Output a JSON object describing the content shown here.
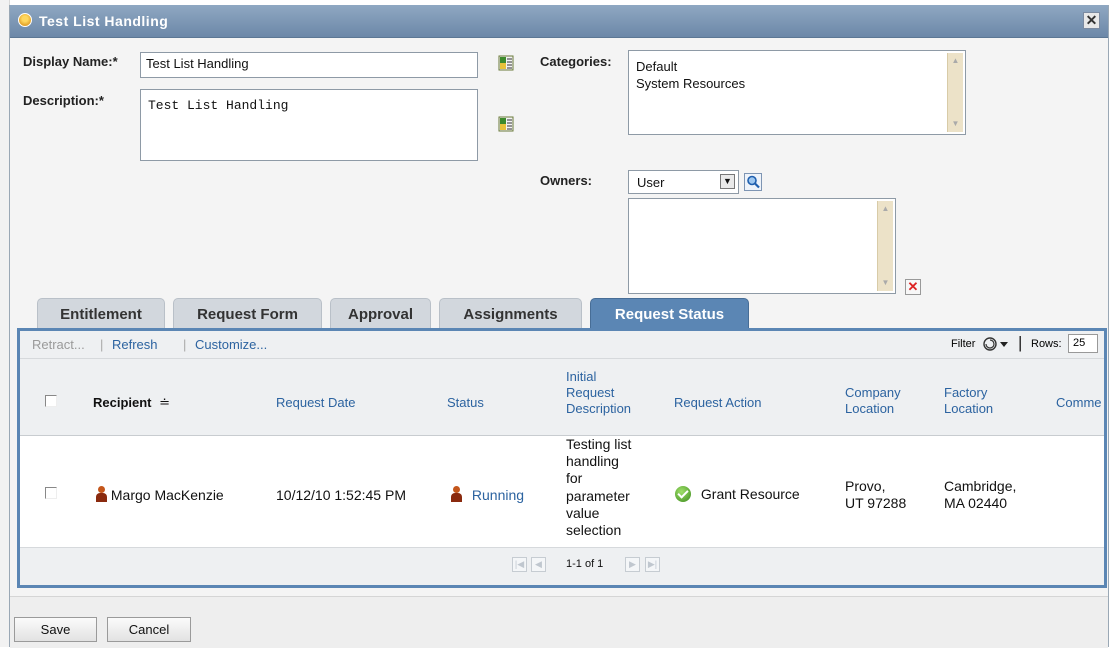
{
  "window": {
    "title": "Test List Handling",
    "close_label": "✕"
  },
  "form": {
    "display_name_label": "Display Name:*",
    "display_name_value": "Test List Handling",
    "description_label": "Description:*",
    "description_value": "Test List Handling",
    "categories_label": "Categories:",
    "categories": [
      "Default",
      "System Resources"
    ],
    "owners_label": "Owners:",
    "owners_type": "User",
    "owners_delete_label": "✕"
  },
  "tabs": [
    {
      "label": "Entitlement"
    },
    {
      "label": "Request Form"
    },
    {
      "label": "Approval"
    },
    {
      "label": "Assignments"
    },
    {
      "label": "Request Status",
      "active": true
    }
  ],
  "toolbar": {
    "retract": "Retract...",
    "refresh": "Refresh",
    "customize": "Customize...",
    "filter": "Filter",
    "rows_label": "Rows:",
    "rows_value": "25"
  },
  "table": {
    "columns": {
      "recipient": "Recipient",
      "recipient_sort": "≐",
      "request_date": "Request Date",
      "status": "Status",
      "initial_request_description": [
        "Initial",
        "Request",
        "Description"
      ],
      "request_action": "Request Action",
      "company_location": [
        "Company",
        "Location"
      ],
      "factory_location": [
        "Factory",
        "Location"
      ],
      "comments": "Comme"
    },
    "rows": [
      {
        "recipient": "Margo MacKenzie",
        "request_date": "10/12/10 1:52:45 PM",
        "status": "Running",
        "description_lines": [
          "Testing list",
          "handling",
          "for",
          "parameter",
          "value",
          "selection"
        ],
        "request_action": "Grant Resource",
        "company_location": [
          "Provo,",
          "UT 97288"
        ],
        "factory_location": [
          "Cambridge,",
          "MA 02440"
        ]
      }
    ]
  },
  "pager": {
    "text": "1-1 of 1"
  },
  "buttons": {
    "save": "Save",
    "cancel": "Cancel"
  }
}
